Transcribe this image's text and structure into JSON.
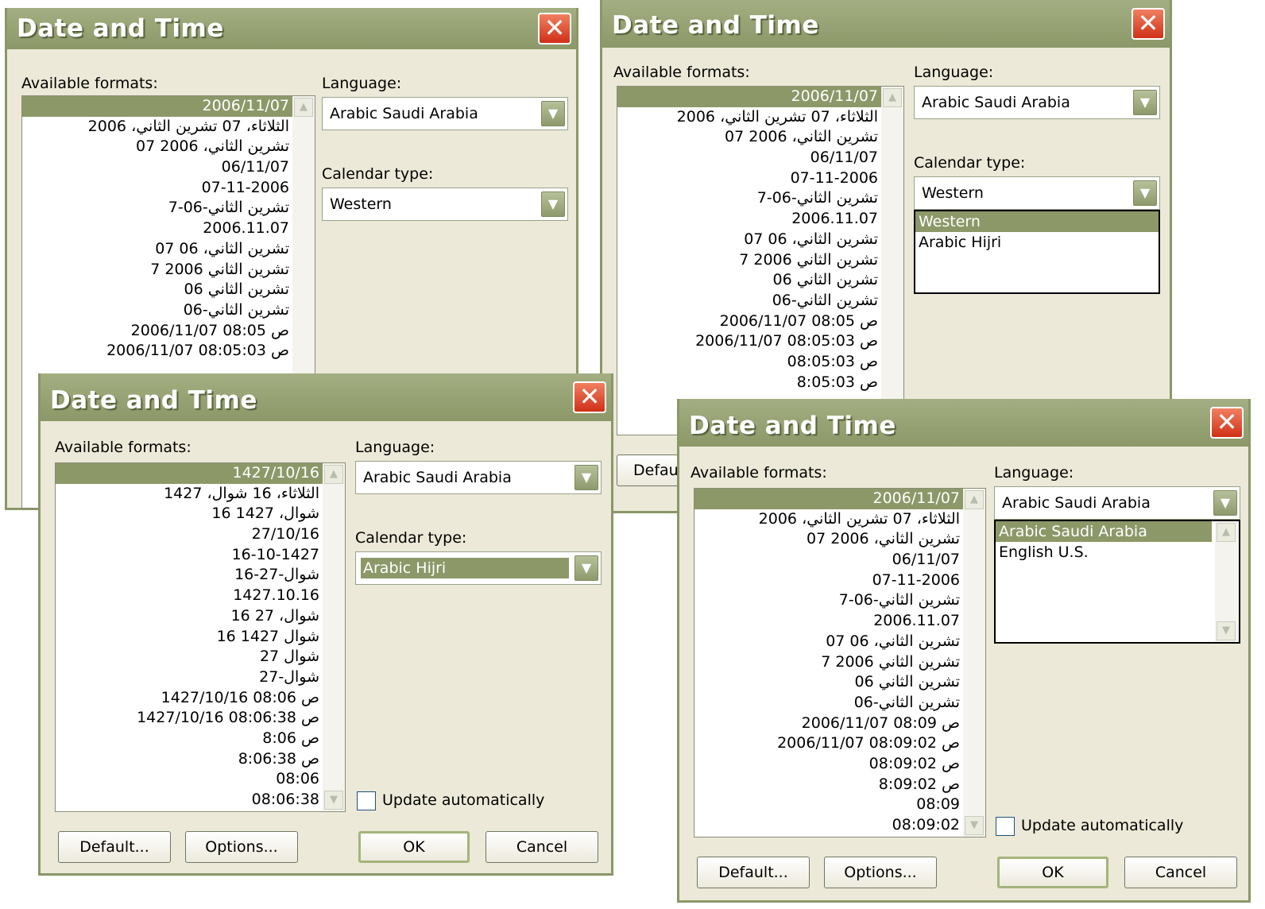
{
  "dialog_title": "Date and Time",
  "labels": {
    "available_formats": "Available formats:",
    "language": "Language:",
    "calendar_type": "Calendar type:",
    "update_automatically": "Update automatically",
    "default_button": "Default...",
    "options_button": "Options...",
    "ok_button": "OK",
    "cancel_button": "Cancel",
    "default_button_truncated": "Defau"
  },
  "icons": {
    "close": "close-x-icon",
    "dropdown_arrow": "chevron-down-icon",
    "scroll_up": "scroll-up-icon",
    "scroll_down": "scroll-down-icon"
  },
  "colors": {
    "titlebar": "#8c9868",
    "selection": "#8c9868",
    "dialog_bg": "#ece9d8",
    "close": "#d03018"
  },
  "dialog1": {
    "language": "Arabic Saudi Arabia",
    "calendar": "Western",
    "formats": [
      "2006/11/07",
      "الثلاثاء، 07 تشرين الثاني، 2006",
      "07 تشرين الثاني، 2006",
      "06/11/07",
      "07-11-2006",
      "7-تشرين الثاني-06",
      "2006.11.07",
      "07 تشرين الثاني، 06",
      "7 تشرين الثاني 2006",
      "تشرين الثاني 06",
      "تشرين الثاني-06",
      "2006/11/07 08:05 ص",
      "2006/11/07 08:05:03 ص"
    ]
  },
  "dialog2": {
    "language": "Arabic Saudi Arabia",
    "calendar": "Western",
    "calendar_options": [
      "Western",
      "Arabic Hijri"
    ],
    "formats": [
      "2006/11/07",
      "الثلاثاء، 07 تشرين الثاني، 2006",
      "07 تشرين الثاني، 2006",
      "06/11/07",
      "07-11-2006",
      "7-تشرين الثاني-06",
      "2006.11.07",
      "07 تشرين الثاني، 06",
      "7 تشرين الثاني 2006",
      "تشرين الثاني 06",
      "تشرين الثاني-06",
      "2006/11/07 08:05 ص",
      "2006/11/07 08:05:03 ص",
      "08:05:03 ص",
      "8:05:03 ص"
    ]
  },
  "dialog3": {
    "language": "Arabic Saudi Arabia",
    "calendar": "Arabic Hijri",
    "formats": [
      "1427/10/16",
      "الثلاثاء، 16 شوال، 1427",
      "16 شوال، 1427",
      "27/10/16",
      "16-10-1427",
      "16-شوال-27",
      "1427.10.16",
      "16 شوال، 27",
      "16 شوال 1427",
      "شوال 27",
      "شوال-27",
      "1427/10/16 08:06 ص",
      "1427/10/16 08:06:38 ص",
      "8:06 ص",
      "8:06:38 ص",
      "08:06",
      "08:06:38"
    ]
  },
  "dialog4": {
    "language": "Arabic Saudi Arabia",
    "language_options": [
      "Arabic Saudi Arabia",
      "English U.S."
    ],
    "formats": [
      "2006/11/07",
      "الثلاثاء، 07 تشرين الثاني، 2006",
      "07 تشرين الثاني، 2006",
      "06/11/07",
      "07-11-2006",
      "7-تشرين الثاني-06",
      "2006.11.07",
      "07 تشرين الثاني، 06",
      "7 تشرين الثاني 2006",
      "تشرين الثاني 06",
      "تشرين الثاني-06",
      "2006/11/07 08:09 ص",
      "2006/11/07 08:09:02 ص",
      "08:09:02 ص",
      "8:09:02 ص",
      "08:09",
      "08:09:02"
    ]
  }
}
